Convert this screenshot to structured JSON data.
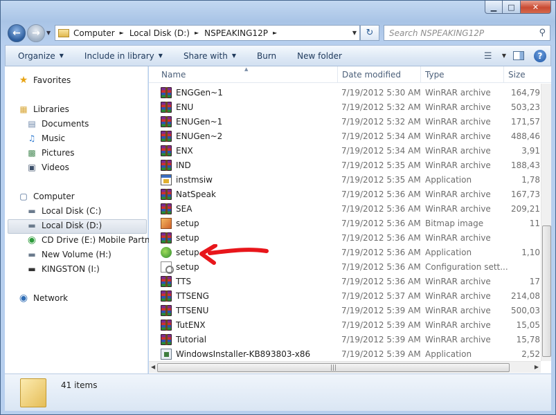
{
  "window": {
    "caption_buttons": {
      "minimize": "▁",
      "maximize": "□",
      "close": "✕"
    },
    "colors": {
      "frame": "#b7cfee",
      "selection": "#d8dfe8",
      "annotation_arrow": "#e8161b"
    }
  },
  "address_bar": {
    "crumbs": [
      "Computer",
      "Local Disk (D:)",
      "NSPEAKING12P"
    ]
  },
  "search": {
    "placeholder": "Search NSPEAKING12P"
  },
  "toolbar": {
    "organize": "Organize",
    "include_in_library": "Include in library",
    "share_with": "Share with",
    "burn": "Burn",
    "new_folder": "New folder"
  },
  "nav": {
    "favorites": "Favorites",
    "libraries": "Libraries",
    "documents": "Documents",
    "music": "Music",
    "pictures": "Pictures",
    "videos": "Videos",
    "computer": "Computer",
    "local_c": "Local Disk (C:)",
    "local_d": "Local Disk (D:)",
    "cd_drive": "CD Drive (E:) Mobile Partner",
    "new_volume": "New Volume (H:)",
    "kingston": "KINGSTON (I:)",
    "network": "Network"
  },
  "columns": {
    "name": "Name",
    "date": "Date modified",
    "type": "Type",
    "size": "Size"
  },
  "files": [
    {
      "name": "ENGGen~1",
      "date": "7/19/2012 5:30 AM",
      "type": "WinRAR archive",
      "size": "164,79",
      "icon": "rar"
    },
    {
      "name": "ENU",
      "date": "7/19/2012 5:32 AM",
      "type": "WinRAR archive",
      "size": "503,23",
      "icon": "rar"
    },
    {
      "name": "ENUGen~1",
      "date": "7/19/2012 5:32 AM",
      "type": "WinRAR archive",
      "size": "171,57",
      "icon": "rar"
    },
    {
      "name": "ENUGen~2",
      "date": "7/19/2012 5:34 AM",
      "type": "WinRAR archive",
      "size": "488,46",
      "icon": "rar"
    },
    {
      "name": "ENX",
      "date": "7/19/2012 5:34 AM",
      "type": "WinRAR archive",
      "size": "3,91",
      "icon": "rar"
    },
    {
      "name": "IND",
      "date": "7/19/2012 5:35 AM",
      "type": "WinRAR archive",
      "size": "188,43",
      "icon": "rar"
    },
    {
      "name": "instmsiw",
      "date": "7/19/2012 5:35 AM",
      "type": "Application",
      "size": "1,78",
      "icon": "app"
    },
    {
      "name": "NatSpeak",
      "date": "7/19/2012 5:36 AM",
      "type": "WinRAR archive",
      "size": "167,73",
      "icon": "rar"
    },
    {
      "name": "SEA",
      "date": "7/19/2012 5:36 AM",
      "type": "WinRAR archive",
      "size": "209,21",
      "icon": "rar"
    },
    {
      "name": "setup",
      "date": "7/19/2012 5:36 AM",
      "type": "Bitmap image",
      "size": "11",
      "icon": "bmp"
    },
    {
      "name": "setup",
      "date": "7/19/2012 5:36 AM",
      "type": "WinRAR archive",
      "size": "",
      "icon": "rar"
    },
    {
      "name": "setup",
      "date": "7/19/2012 5:36 AM",
      "type": "Application",
      "size": "1,10",
      "icon": "leaf"
    },
    {
      "name": "setup",
      "date": "7/19/2012 5:36 AM",
      "type": "Configuration sett...",
      "size": "",
      "icon": "cfg"
    },
    {
      "name": "TTS",
      "date": "7/19/2012 5:36 AM",
      "type": "WinRAR archive",
      "size": "17",
      "icon": "rar"
    },
    {
      "name": "TTSENG",
      "date": "7/19/2012 5:37 AM",
      "type": "WinRAR archive",
      "size": "214,08",
      "icon": "rar"
    },
    {
      "name": "TTSENU",
      "date": "7/19/2012 5:39 AM",
      "type": "WinRAR archive",
      "size": "500,03",
      "icon": "rar"
    },
    {
      "name": "TutENX",
      "date": "7/19/2012 5:39 AM",
      "type": "WinRAR archive",
      "size": "15,05",
      "icon": "rar"
    },
    {
      "name": "Tutorial",
      "date": "7/19/2012 5:39 AM",
      "type": "WinRAR archive",
      "size": "15,78",
      "icon": "rar"
    },
    {
      "name": "WindowsInstaller-KB893803-x86",
      "date": "7/19/2012 5:39 AM",
      "type": "Application",
      "size": "2,52",
      "icon": "msi"
    }
  ],
  "details": {
    "item_count": "41 items"
  }
}
